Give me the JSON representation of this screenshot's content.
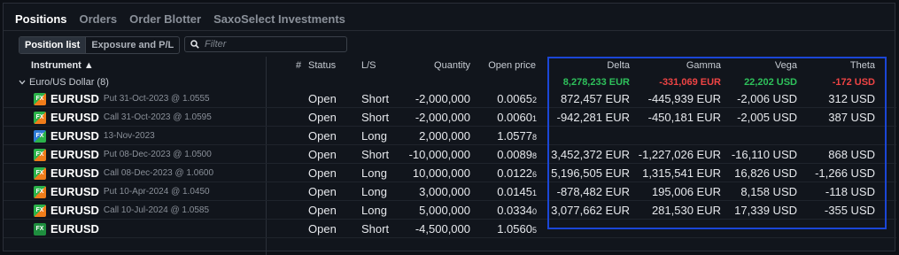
{
  "tabs": [
    "Positions",
    "Orders",
    "Order Blotter",
    "SaxoSelect Investments"
  ],
  "view_toggle": [
    "Position list",
    "Exposure and P/L"
  ],
  "filter": {
    "placeholder": "Filter"
  },
  "columns": {
    "instrument": "Instrument ▲",
    "count": "#",
    "status": "Status",
    "ls": "L/S",
    "quantity": "Quantity",
    "open_price": "Open price",
    "delta": "Delta",
    "gamma": "Gamma",
    "vega": "Vega",
    "theta": "Theta"
  },
  "group": {
    "label": "Euro/US Dollar (8)",
    "delta": "8,278,233 EUR",
    "gamma": "-331,069 EUR",
    "vega": "22,202 USD",
    "theta": "-172 USD"
  },
  "rows": [
    {
      "icon": "fx-option-icon",
      "icon_text": "FX",
      "symbol": "EURUSD",
      "detail": "Put 31-Oct-2023 @ 1.0555",
      "status": "Open",
      "ls": "Short",
      "quantity": "-2,000,000",
      "price_main": "0.0065",
      "price_small": "2",
      "delta": "872,457 EUR",
      "gamma": "-445,939 EUR",
      "vega": "-2,006 USD",
      "theta": "312 USD"
    },
    {
      "icon": "fx-option-icon",
      "icon_text": "FX",
      "symbol": "EURUSD",
      "detail": "Call 31-Oct-2023 @ 1.0595",
      "status": "Open",
      "ls": "Short",
      "quantity": "-2,000,000",
      "price_main": "0.0060",
      "price_small": "1",
      "delta": "-942,281 EUR",
      "gamma": "-450,181 EUR",
      "vega": "-2,005 USD",
      "theta": "387 USD"
    },
    {
      "icon": "fx-forward-icon",
      "icon_text": "FX",
      "symbol": "EURUSD",
      "detail": "13-Nov-2023",
      "status": "Open",
      "ls": "Long",
      "quantity": "2,000,000",
      "price_main": "1.0577",
      "price_small": "8",
      "delta": "",
      "gamma": "",
      "vega": "",
      "theta": ""
    },
    {
      "icon": "fx-option-icon",
      "icon_text": "FX",
      "symbol": "EURUSD",
      "detail": "Put 08-Dec-2023 @ 1.0500",
      "status": "Open",
      "ls": "Short",
      "quantity": "-10,000,000",
      "price_main": "0.0089",
      "price_small": "8",
      "delta": "3,452,372 EUR",
      "gamma": "-1,227,026 EUR",
      "vega": "-16,110 USD",
      "theta": "868 USD"
    },
    {
      "icon": "fx-option-icon",
      "icon_text": "FX",
      "symbol": "EURUSD",
      "detail": "Call 08-Dec-2023 @ 1.0600",
      "status": "Open",
      "ls": "Long",
      "quantity": "10,000,000",
      "price_main": "0.0122",
      "price_small": "6",
      "delta": "5,196,505 EUR",
      "gamma": "1,315,541 EUR",
      "vega": "16,826 USD",
      "theta": "-1,266 USD"
    },
    {
      "icon": "fx-option-icon",
      "icon_text": "FX",
      "symbol": "EURUSD",
      "detail": "Put 10-Apr-2024 @ 1.0450",
      "status": "Open",
      "ls": "Long",
      "quantity": "3,000,000",
      "price_main": "0.0145",
      "price_small": "1",
      "delta": "-878,482 EUR",
      "gamma": "195,006 EUR",
      "vega": "8,158 USD",
      "theta": "-118 USD"
    },
    {
      "icon": "fx-option-icon",
      "icon_text": "FX",
      "symbol": "EURUSD",
      "detail": "Call 10-Jul-2024 @ 1.0585",
      "status": "Open",
      "ls": "Long",
      "quantity": "5,000,000",
      "price_main": "0.0334",
      "price_small": "0",
      "delta": "3,077,662 EUR",
      "gamma": "281,530 EUR",
      "vega": "17,339 USD",
      "theta": "-355 USD"
    },
    {
      "icon": "fx-spot-icon",
      "icon_text": "FX",
      "symbol": "EURUSD",
      "detail": "",
      "status": "Open",
      "ls": "Short",
      "quantity": "-4,500,000",
      "price_main": "1.0560",
      "price_small": "5",
      "delta": "",
      "gamma": "",
      "vega": "",
      "theta": ""
    }
  ],
  "colors": {
    "highlight_border": "#1b46d6",
    "positive": "#2ec15b",
    "negative": "#ef4444"
  }
}
